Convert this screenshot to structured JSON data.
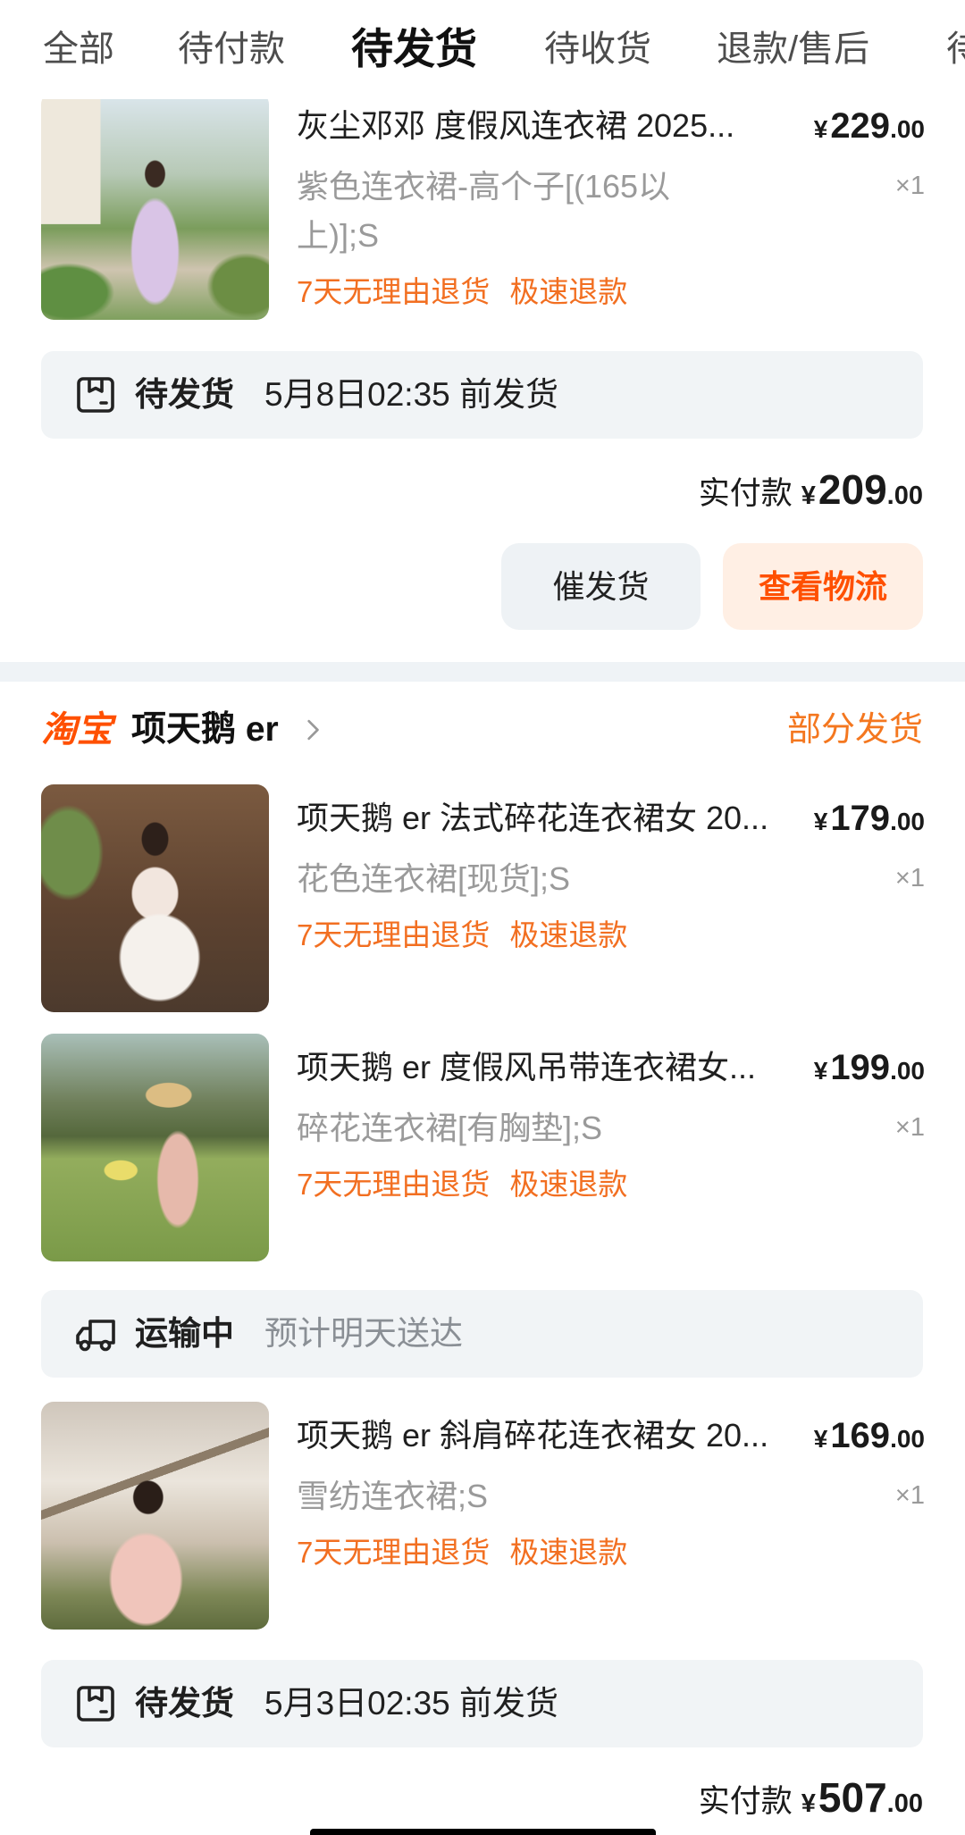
{
  "tabs": [
    {
      "label": "全部"
    },
    {
      "label": "待付款"
    },
    {
      "label": "待发货",
      "active": true
    },
    {
      "label": "待收货"
    },
    {
      "label": "退款/售后"
    },
    {
      "label": "待"
    }
  ],
  "orders": [
    {
      "items": [
        {
          "title": "灰尘邓邓 度假风连衣裙 2025...",
          "price": {
            "symbol": "¥",
            "integer": "229",
            "decimal": ".00"
          },
          "variant": "紫色连衣裙-高个子[(165以上)];S",
          "quantity": "×1",
          "tags": [
            "7天无理由退货",
            "极速退款"
          ]
        }
      ],
      "shipments": [
        {
          "icon": "package-icon",
          "status": "待发货",
          "note": "5月8日02:35 前发货"
        }
      ],
      "payment": {
        "label": "实付款",
        "symbol": "¥",
        "integer": "209",
        "decimal": ".00"
      },
      "actions": [
        "催发货",
        "查看物流"
      ]
    },
    {
      "shop": {
        "platform": "淘宝",
        "name": "项天鹅 er",
        "chevron_icon": "chevron-right-icon",
        "status": "部分发货"
      },
      "items": [
        {
          "title": "项天鹅 er 法式碎花连衣裙女 20...",
          "price": {
            "symbol": "¥",
            "integer": "179",
            "decimal": ".00"
          },
          "variant": "花色连衣裙[现货];S",
          "quantity": "×1",
          "tags": [
            "7天无理由退货",
            "极速退款"
          ]
        },
        {
          "title": "项天鹅 er 度假风吊带连衣裙女...",
          "price": {
            "symbol": "¥",
            "integer": "199",
            "decimal": ".00"
          },
          "variant": "碎花连衣裙[有胸垫];S",
          "quantity": "×1",
          "tags": [
            "7天无理由退货",
            "极速退款"
          ]
        },
        {
          "title": "项天鹅 er 斜肩碎花连衣裙女 20...",
          "price": {
            "symbol": "¥",
            "integer": "169",
            "decimal": ".00"
          },
          "variant": "雪纺连衣裙;S",
          "quantity": "×1",
          "tags": [
            "7天无理由退货",
            "极速退款"
          ]
        }
      ],
      "shipments": [
        {
          "icon": "truck-icon",
          "status": "运输中",
          "note": "预计明天送达"
        },
        {
          "icon": "package-icon",
          "status": "待发货",
          "note": "5月3日02:35 前发货"
        }
      ],
      "payment": {
        "label": "实付款",
        "symbol": "¥",
        "integer": "507",
        "decimal": ".00"
      }
    }
  ],
  "colors": {
    "brand": "#ff5000",
    "tag": "#f26f21",
    "shop_status": "#f4771f",
    "status_box_bg": "#f1f4f6",
    "separator": "#eff3f6",
    "muted_text": "#9a9a9a"
  }
}
